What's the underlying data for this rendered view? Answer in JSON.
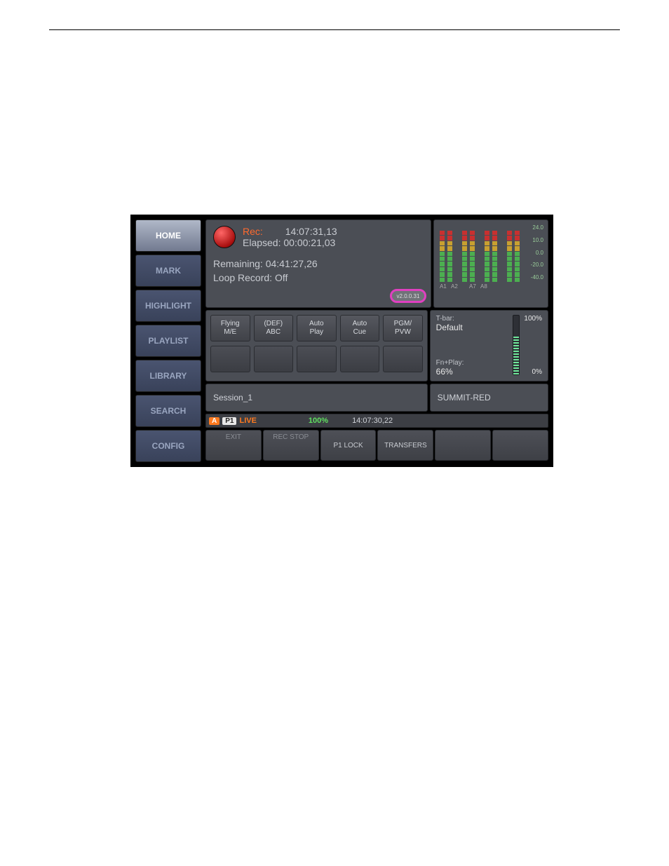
{
  "sidebar": {
    "items": [
      {
        "label": "HOME"
      },
      {
        "label": "MARK"
      },
      {
        "label": "HIGHLIGHT"
      },
      {
        "label": "PLAYLIST"
      },
      {
        "label": "LIBRARY"
      },
      {
        "label": "SEARCH"
      },
      {
        "label": "CONFIG"
      }
    ]
  },
  "rec": {
    "rec_label": "Rec:",
    "rec_tc": "14:07:31,13",
    "elapsed_label": "Elapsed:",
    "elapsed_val": "00:00:21,03",
    "remaining_label": "Remaining:",
    "remaining_val": "04:41:27,26",
    "loop_label": "Loop Record:",
    "loop_val": "Off",
    "version": "v2.0.0.31"
  },
  "meters": {
    "labels": [
      "A1",
      "A2",
      "A7",
      "A8"
    ],
    "db_scale": [
      "24.0",
      "10.0",
      "0.0",
      "-20.0",
      "-40.0"
    ]
  },
  "modes": {
    "row1": [
      {
        "l1": "Flying",
        "l2": "M/E"
      },
      {
        "l1": "(DEF)",
        "l2": "ABC"
      },
      {
        "l1": "Auto",
        "l2": "Play"
      },
      {
        "l1": "Auto",
        "l2": "Cue"
      },
      {
        "l1": "PGM/",
        "l2": "PVW"
      }
    ]
  },
  "tbar": {
    "tbar_label": "T-bar:",
    "tbar_mode": "Default",
    "top_pct": "100%",
    "fn_label": "Fn+Play:",
    "fn_val": "66%",
    "bottom_pct": "0%"
  },
  "session": {
    "name": "Session_1",
    "device": "SUMMIT-RED"
  },
  "status": {
    "a": "A",
    "p": "P1",
    "live": "LIVE",
    "pct": "100%",
    "tc": "14:07:30,22"
  },
  "fn": {
    "b1": "EXIT",
    "b2": "REC STOP",
    "b3": "P1 LOCK",
    "b4": "TRANSFERS"
  }
}
